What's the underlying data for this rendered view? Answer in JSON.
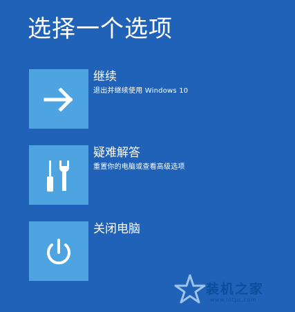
{
  "page_title": "选择一个选项",
  "options": [
    {
      "title": "继续",
      "description": "退出并继续使用 Windows 10",
      "icon": "arrow-right-icon"
    },
    {
      "title": "疑难解答",
      "description": "重置你的电脑或查看高级选项",
      "icon": "tools-icon"
    },
    {
      "title": "关闭电脑",
      "description": "",
      "icon": "power-icon"
    }
  ],
  "watermark": {
    "text": "装机之家",
    "url": "www.lotpc.com"
  },
  "colors": {
    "background": "#1f62b8",
    "tile": "#4ea4e1",
    "text": "#ffffff"
  }
}
